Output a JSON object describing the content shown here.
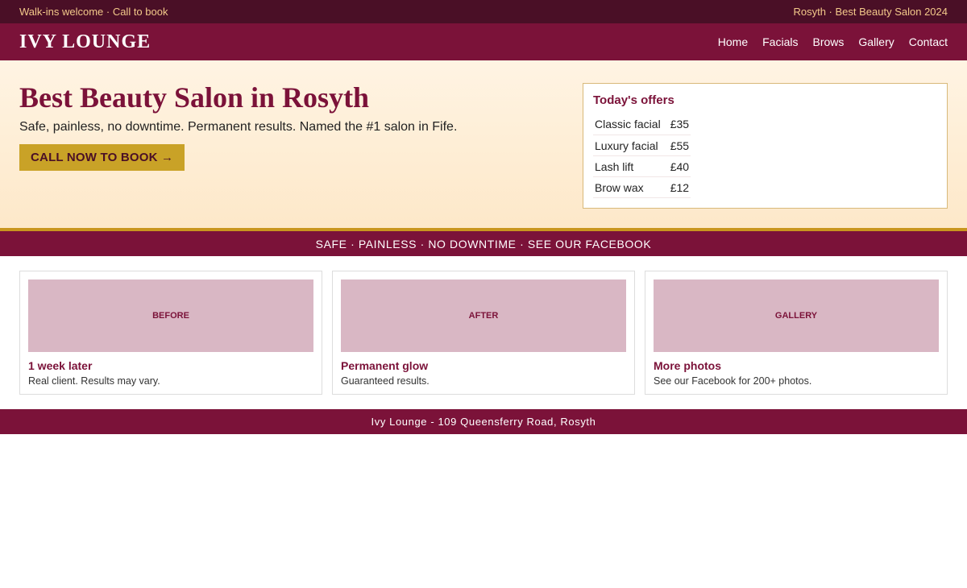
{
  "topbar": {
    "left": "Walk-ins welcome · Call to book",
    "right": "Rosyth · Best Beauty Salon 2024"
  },
  "header": {
    "logo": "IVY LOUNGE",
    "nav": [
      "Home",
      "Facials",
      "Brows",
      "Gallery",
      "Contact"
    ]
  },
  "hero": {
    "title": "Best Beauty Salon in Rosyth",
    "subtitle": "Safe, painless, no downtime. Permanent results. Named the #1 salon in Fife.",
    "cta_label": "CALL NOW TO BOOK →"
  },
  "offers": {
    "title": "Today's offers",
    "items": [
      {
        "name": "Classic facial",
        "price": "£35"
      },
      {
        "name": "Luxury facial",
        "price": "£55"
      },
      {
        "name": "Lash lift",
        "price": "£40"
      },
      {
        "name": "Brow wax",
        "price": "£12"
      }
    ]
  },
  "strip": {
    "text": "SAFE · PAINLESS · NO DOWNTIME · SEE OUR FACEBOOK"
  },
  "cards": [
    {
      "image_label": "BEFORE",
      "title": "1 week later",
      "text": "Real client. Results may vary."
    },
    {
      "image_label": "AFTER",
      "title": "Permanent glow",
      "text": "Guaranteed results."
    },
    {
      "image_label": "GALLERY",
      "title": "More photos",
      "text": "See our Facebook for 200+ photos."
    }
  ],
  "footer": {
    "text": "Ivy Lounge - 109 Queensferry Road, Rosyth"
  },
  "colors": {
    "brand": "#7b1239",
    "brand_dark": "#4a0f26",
    "accent_gold": "#c9a227",
    "hero_bg": "#fde8c9"
  }
}
